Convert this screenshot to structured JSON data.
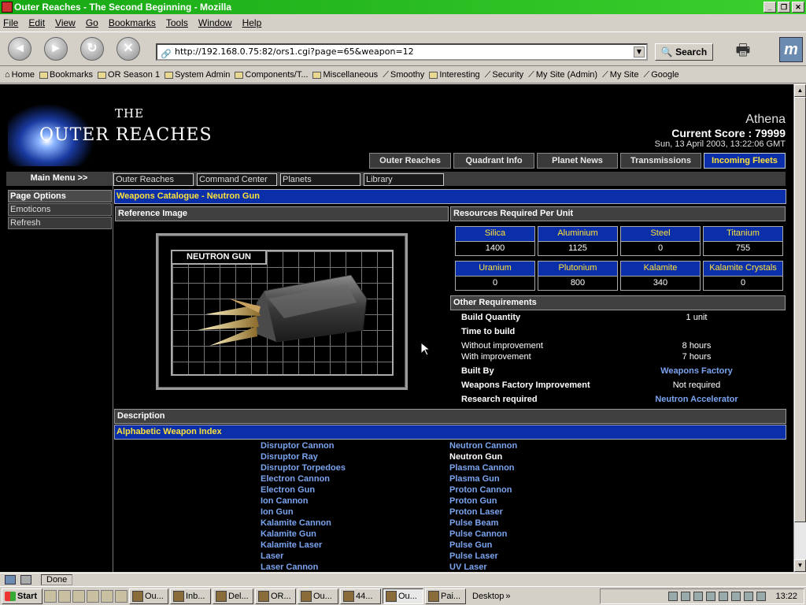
{
  "window": {
    "title": "Outer Reaches - The Second Beginning - Mozilla",
    "buttons": [
      "_",
      "❐",
      "✕"
    ]
  },
  "menu": [
    "File",
    "Edit",
    "View",
    "Go",
    "Bookmarks",
    "Tools",
    "Window",
    "Help"
  ],
  "nav": {
    "url": "http://192.168.0.75:82/ors1.cgi?page=65&weapon=12",
    "search_label": "Search"
  },
  "bookmarks": [
    "Home",
    "Bookmarks",
    "OR Season 1",
    "System Admin",
    "Components/T...",
    "Miscellaneous",
    "Smoothy",
    "Interesting",
    "Security",
    "My Site (Admin)",
    "My Site",
    "Google"
  ],
  "site": {
    "logo_the": "THE",
    "logo_name": "OUTER REACHES",
    "player": "Athena",
    "score": "Current Score : 79999",
    "date": "Sun, 13 April 2003, 13:22:06 GMT",
    "top_tabs": [
      {
        "label": "Outer Reaches"
      },
      {
        "label": "Quadrant Info"
      },
      {
        "label": "Planet News"
      },
      {
        "label": "Transmissions"
      },
      {
        "label": "Incoming Fleets",
        "active": true
      }
    ],
    "main_menu_label": "Main Menu >>",
    "sub_tabs": [
      "Outer Reaches",
      "Command Center",
      "Planets",
      "Library"
    ],
    "left_nav": {
      "header": "Page Options",
      "items": [
        "Emoticons",
        "Refresh"
      ]
    }
  },
  "content": {
    "heading": "Weapons Catalogue - Neutron Gun",
    "reference_label": "Reference Image",
    "weapon_name": "NEUTRON GUN",
    "resources_label": "Resources Required Per Unit",
    "resources": [
      {
        "name": "Silica",
        "value": "1400"
      },
      {
        "name": "Aluminium",
        "value": "1125"
      },
      {
        "name": "Steel",
        "value": "0"
      },
      {
        "name": "Titanium",
        "value": "755"
      },
      {
        "name": "Uranium",
        "value": "0"
      },
      {
        "name": "Plutonium",
        "value": "800"
      },
      {
        "name": "Kalamite",
        "value": "340"
      },
      {
        "name": "Kalamite Crystals",
        "value": "0"
      }
    ],
    "other_label": "Other Requirements",
    "requirements": {
      "build_quantity_label": "Build Quantity",
      "build_quantity": "1 unit",
      "time_label": "Time to build",
      "without_label": "Without improvement",
      "without_value": "8 hours",
      "with_label": "With improvement",
      "with_value": "7 hours",
      "built_by_label": "Built By",
      "built_by": "Weapons Factory",
      "improvement_label": "Weapons Factory Improvement",
      "improvement": "Not required",
      "research_label": "Research required",
      "research": "Neutron Accelerator"
    },
    "description_label": "Description",
    "index_label": "Alphabetic Weapon Index",
    "index_left": [
      "Disruptor Cannon",
      "Disruptor Ray",
      "Disruptor Torpedoes",
      "Electron Cannon",
      "Electron Gun",
      "Ion Cannon",
      "Ion Gun",
      "Kalamite Cannon",
      "Kalamite Gun",
      "Kalamite Laser",
      "Laser",
      "Laser Cannon"
    ],
    "index_right": [
      "Neutron Cannon",
      "Neutron Gun",
      "Plasma Cannon",
      "Plasma Gun",
      "Proton Cannon",
      "Proton Gun",
      "Proton Laser",
      "Pulse Beam",
      "Pulse Cannon",
      "Pulse Gun",
      "Pulse Laser",
      "UV Laser"
    ]
  },
  "status": {
    "text": "Done"
  },
  "taskbar": {
    "start": "Start",
    "tasks": [
      "Ou...",
      "Inb...",
      "Del...",
      "OR...",
      "Ou...",
      "44...",
      "Ou...",
      "Pai..."
    ],
    "desktop": "Desktop",
    "clock": "13:22"
  }
}
